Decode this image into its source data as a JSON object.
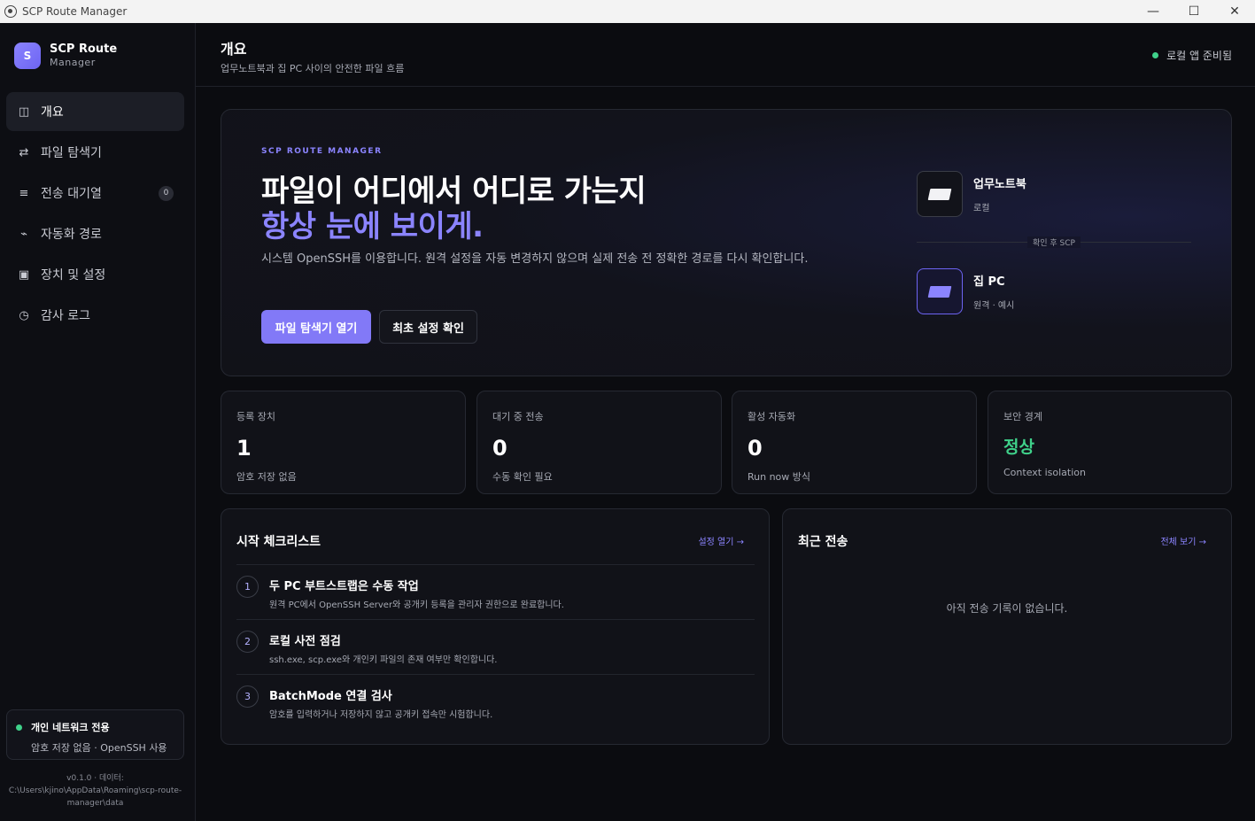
{
  "window": {
    "title": "SCP Route Manager",
    "minimize": "—",
    "maximize": "☐",
    "close": "✕"
  },
  "sidebar": {
    "brand": {
      "logo": "S",
      "name": "SCP Route",
      "sub": "Manager"
    },
    "items": [
      {
        "icon": "◫",
        "label": "개요"
      },
      {
        "icon": "⇄",
        "label": "파일 탐색기"
      },
      {
        "icon": "≡",
        "label": "전송 대기열",
        "badge": "0"
      },
      {
        "icon": "⌁",
        "label": "자동화 경로"
      },
      {
        "icon": "▣",
        "label": "장치 및 설정"
      },
      {
        "icon": "◷",
        "label": "감사 로그"
      }
    ],
    "network": {
      "title": "개인 네트워크 전용",
      "subtitle": "암호 저장 없음 · OpenSSH 사용"
    },
    "version": {
      "line1": "v0.1.0 · 데이터:",
      "line2": "C:\\Users\\kjino\\AppData\\Roaming\\scp-route-",
      "line3": "manager\\data"
    }
  },
  "header": {
    "title": "개요",
    "subtitle": "업무노트북과 집 PC 사이의 안전한 파일 흐름",
    "status": "로컬 앱 준비됨"
  },
  "hero": {
    "kicker": "SCP ROUTE MANAGER",
    "title_line1": "파일이 어디에서 어디로 가는지",
    "title_line2": "항상 눈에 보이게.",
    "description": "시스템 OpenSSH를 이용합니다. 원격 설정을 자동 변경하지 않으며 실제 전송 전 정확한 경로를 다시 확인합니다.",
    "primary_button": "파일 탐색기 열기",
    "secondary_button": "최초 설정 확인",
    "local_device": {
      "name": "업무노트북",
      "sub": "로컬"
    },
    "route_label": "확인 후 SCP",
    "remote_device": {
      "name": "집 PC",
      "sub": "원격 · 예시"
    }
  },
  "stats": [
    {
      "label": "등록 장치",
      "value": "1",
      "note": "암호 저장 없음"
    },
    {
      "label": "대기 중 전송",
      "value": "0",
      "note": "수동 확인 필요"
    },
    {
      "label": "활성 자동화",
      "value": "0",
      "note": "Run now 방식"
    },
    {
      "label": "보안 경계",
      "value": "정상",
      "note": "Context isolation"
    }
  ],
  "checklist": {
    "title": "시작 체크리스트",
    "link": "설정 열기 →",
    "items": [
      {
        "num": "1",
        "title": "두 PC 부트스트랩은 수동 작업",
        "desc": "원격 PC에서 OpenSSH Server와 공개키 등록을 관리자 권한으로 완료합니다."
      },
      {
        "num": "2",
        "title": "로컬 사전 점검",
        "desc": "ssh.exe, scp.exe와 개인키 파일의 존재 여부만 확인합니다."
      },
      {
        "num": "3",
        "title": "BatchMode 연결 검사",
        "desc": "암호를 입력하거나 저장하지 않고 공개키 접속만 시험합니다."
      }
    ]
  },
  "recent": {
    "title": "최근 전송",
    "link": "전체 보기 →",
    "empty": "아직 전송 기록이 없습니다."
  },
  "colors": {
    "accent": "#8b84ff",
    "ok": "#3fd18a",
    "background": "#0b0c10"
  }
}
